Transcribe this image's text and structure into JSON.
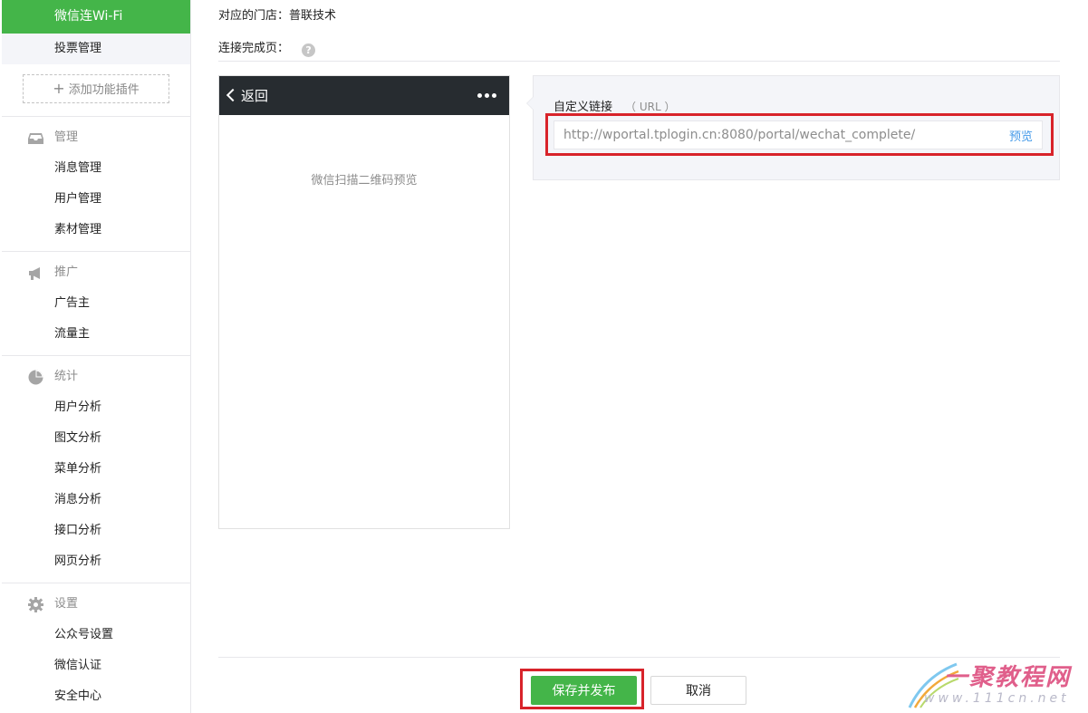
{
  "sidebar": {
    "active_item": "微信连Wi-Fi",
    "vote_item": "投票管理",
    "add_plugin": "添加功能插件",
    "add_plugin_icon": "plus-icon",
    "groups": [
      {
        "title": "管理",
        "icon": "inbox-icon",
        "items": [
          "消息管理",
          "用户管理",
          "素材管理"
        ]
      },
      {
        "title": "推广",
        "icon": "megaphone-icon",
        "items": [
          "广告主",
          "流量主"
        ]
      },
      {
        "title": "统计",
        "icon": "pie-chart-icon",
        "items": [
          "用户分析",
          "图文分析",
          "菜单分析",
          "消息分析",
          "接口分析",
          "网页分析"
        ]
      },
      {
        "title": "设置",
        "icon": "gear-icon",
        "items": [
          "公众号设置",
          "微信认证",
          "安全中心"
        ]
      }
    ]
  },
  "main": {
    "store_label": "对应的门店：普联技术",
    "complete_page_label": "连接完成页：",
    "help_icon": "?",
    "phone": {
      "back_label": "返回",
      "preview_text": "微信扫描二维码预览"
    },
    "url_panel": {
      "label": "自定义链接",
      "sub_label": "（ URL ）",
      "url_value": "http://wportal.tplogin.cn:8080/portal/wechat_complete/",
      "preview_link": "预览"
    },
    "save_button": "保存并发布",
    "cancel_button": "取消"
  },
  "watermark": {
    "cn": "一聚教程网",
    "en": "www.111cn.net"
  },
  "colors": {
    "accent_green": "#44b549",
    "highlight_red": "#d8232a",
    "link_blue": "#459ae9",
    "phone_bar": "#272c30"
  }
}
